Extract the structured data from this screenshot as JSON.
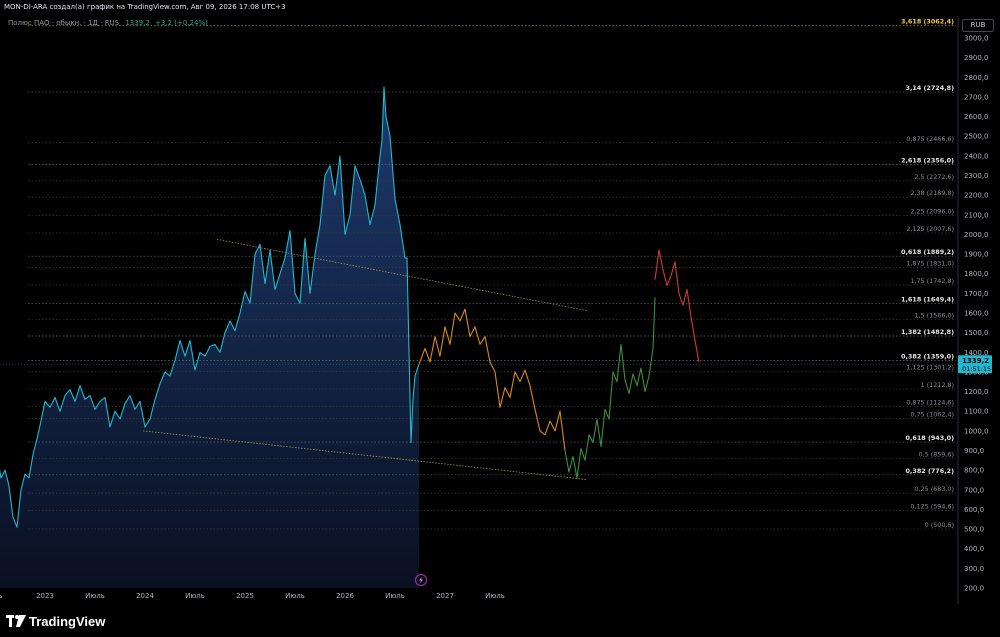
{
  "header": {
    "author_line": "MON-DI-ARA создал(а) график на TradingView.com, Авг 09, 2026 17:08 UTC+3",
    "symbol": "Полюс ПАО · обыкн. · 1Д · RUS",
    "last_price": "1339,2",
    "change": "+3,2 (+0,24%)",
    "currency": "RUB"
  },
  "footer": {
    "brand": "TradingView"
  },
  "colors": {
    "background": "#000000",
    "price_line": "#22b8cf",
    "area_fill": "#1e2d52",
    "projection_orange": "#d98a1a",
    "projection_green": "#3f8f3a",
    "projection_red": "#d13b3b",
    "trendline": "#a8a84a",
    "fib_level": "#5a5a5a",
    "price_tag_bg": "#22b8cf"
  },
  "price_tag": {
    "price": "1339,2",
    "countdown": "01:51:15"
  },
  "event_marker": {
    "icon": "lightning-bolt-icon"
  },
  "chart_data": {
    "type": "line",
    "title": "",
    "xlabel": "",
    "ylabel": "",
    "y_ticks": [
      200,
      300,
      400,
      500,
      600,
      700,
      800,
      900,
      1000,
      1100,
      1200,
      1300,
      1400,
      1500,
      1600,
      1700,
      1800,
      1900,
      2000,
      2100,
      2200,
      2300,
      2400,
      2500,
      2600,
      2700,
      2800,
      2900,
      3000
    ],
    "y_tick_labels": [
      "200,0",
      "300,0",
      "400,0",
      "500,0",
      "600,0",
      "700,0",
      "800,0",
      "900,0",
      "1000,0",
      "1100,0",
      "1200,0",
      "1300,0",
      "1400,0",
      "1500,0",
      "1600,0",
      "1700,0",
      "1800,0",
      "1900,0",
      "2000,0",
      "2100,0",
      "2200,0",
      "2300,0",
      "2400,0",
      "2500,0",
      "2600,0",
      "2700,0",
      "2800,0",
      "2900,0",
      "3000,0"
    ],
    "ylim": [
      160,
      3130
    ],
    "xlim": [
      2022.47,
      2028.42
    ],
    "x_ticks": [
      {
        "label": "юль",
        "x": 2022.5
      },
      {
        "label": "2023",
        "x": 2023.0
      },
      {
        "label": "Июль",
        "x": 2023.5
      },
      {
        "label": "2024",
        "x": 2024.0
      },
      {
        "label": "Июль",
        "x": 2024.5
      },
      {
        "label": "2025",
        "x": 2025.0
      },
      {
        "label": "Июль",
        "x": 2025.5
      },
      {
        "label": "2026",
        "x": 2026.0
      },
      {
        "label": "Июль",
        "x": 2026.5
      },
      {
        "label": "2027",
        "x": 2027.0
      },
      {
        "label": "Июль",
        "x": 2027.5
      }
    ],
    "fib_levels": [
      {
        "label": "0 (500,6)",
        "value": 500.6,
        "strong": false
      },
      {
        "label": "0,125 (594,6)",
        "value": 594.6,
        "strong": false
      },
      {
        "label": "0,25 (683,0)",
        "value": 683.0,
        "strong": false
      },
      {
        "label": "0,382 (776,2)",
        "value": 776.2,
        "strong": true
      },
      {
        "label": "0,5 (859,6)",
        "value": 859.6,
        "strong": false
      },
      {
        "label": "0,618 (943,0)",
        "value": 943.0,
        "strong": true
      },
      {
        "label": "0,75 (1062,4)",
        "value": 1062.4,
        "strong": false
      },
      {
        "label": "0,875 (1124,6)",
        "value": 1124.6,
        "strong": false
      },
      {
        "label": "1 (1212,8)",
        "value": 1212.8,
        "strong": false
      },
      {
        "label": "1,125 (1301,2)",
        "value": 1301.2,
        "strong": false
      },
      {
        "label": "0,382 (1359,0)",
        "value": 1359.0,
        "strong": true
      },
      {
        "label": "1,382 (1482,8)",
        "value": 1482.8,
        "strong": true
      },
      {
        "label": "1,5 (1566,0)",
        "value": 1566.0,
        "strong": false
      },
      {
        "label": "1,618 (1649,4)",
        "value": 1649.4,
        "strong": true
      },
      {
        "label": "1,75 (1742,8)",
        "value": 1742.8,
        "strong": false
      },
      {
        "label": "1,875 (1831,0)",
        "value": 1831.0,
        "strong": false
      },
      {
        "label": "0,618 (1889,2)",
        "value": 1889.2,
        "strong": true
      },
      {
        "label": "2,125 (2007,6)",
        "value": 2007.6,
        "strong": false
      },
      {
        "label": "2,25 (2096,0)",
        "value": 2096.0,
        "strong": false
      },
      {
        "label": "2,38 (2189,8)",
        "value": 2189.8,
        "strong": false
      },
      {
        "label": "2,5 (2272,6)",
        "value": 2272.6,
        "strong": false
      },
      {
        "label": "2,618 (2356,0)",
        "value": 2356.0,
        "strong": true
      },
      {
        "label": "0,875 (2466,6)",
        "value": 2466.6,
        "strong": false
      },
      {
        "label": "3,14 (2724,8)",
        "value": 2724.8,
        "strong": true
      },
      {
        "label": "3,618 (3062,4)",
        "value": 3062.4,
        "strong": true,
        "accent": true
      }
    ],
    "trendlines": [
      {
        "name": "upper",
        "x": [
          2024.72,
          2028.42
        ],
        "y": [
          1975,
          1612
        ]
      },
      {
        "name": "lower",
        "x": [
          2023.98,
          2028.42
        ],
        "y": [
          1000,
          752
        ]
      }
    ],
    "series": [
      {
        "name": "history",
        "color": "#22b8cf",
        "x": [
          2022.47,
          2022.52,
          2022.56,
          2022.6,
          2022.64,
          2022.68,
          2022.72,
          2022.76,
          2022.8,
          2022.84,
          2022.88,
          2022.92,
          2022.96,
          2023.0,
          2023.05,
          2023.1,
          2023.15,
          2023.2,
          2023.25,
          2023.3,
          2023.35,
          2023.4,
          2023.45,
          2023.5,
          2023.55,
          2023.6,
          2023.65,
          2023.7,
          2023.75,
          2023.8,
          2023.85,
          2023.9,
          2023.95,
          2024.0,
          2024.05,
          2024.1,
          2024.15,
          2024.2,
          2024.25,
          2024.3,
          2024.35,
          2024.4,
          2024.45,
          2024.5,
          2024.55,
          2024.6,
          2024.65,
          2024.7,
          2024.75,
          2024.8,
          2024.85,
          2024.9,
          2024.95,
          2025.0,
          2025.05,
          2025.1,
          2025.15,
          2025.2,
          2025.25,
          2025.3,
          2025.35,
          2025.4,
          2025.45,
          2025.5,
          2025.55,
          2025.6,
          2025.65,
          2025.7,
          2025.75,
          2025.8,
          2025.85,
          2025.9,
          2025.95,
          2026.0,
          2026.05,
          2026.1,
          2026.15,
          2026.2,
          2026.25,
          2026.3,
          2026.35,
          2026.37,
          2026.39,
          2026.41,
          2026.45,
          2026.5,
          2026.55,
          2026.6,
          2026.62
        ],
        "y": [
          950,
          880,
          760,
          800,
          720,
          560,
          510,
          700,
          780,
          760,
          880,
          960,
          1050,
          1150,
          1120,
          1170,
          1100,
          1180,
          1210,
          1150,
          1230,
          1160,
          1180,
          1110,
          1150,
          1170,
          1020,
          1100,
          1060,
          1140,
          1180,
          1110,
          1150,
          1020,
          1060,
          1160,
          1240,
          1300,
          1280,
          1360,
          1460,
          1380,
          1460,
          1310,
          1400,
          1380,
          1430,
          1440,
          1400,
          1500,
          1560,
          1510,
          1600,
          1710,
          1650,
          1900,
          1950,
          1750,
          1920,
          1720,
          1800,
          1880,
          2020,
          1700,
          1650,
          1980,
          1700,
          1900,
          2050,
          2300,
          2350,
          2200,
          2400,
          2000,
          2100,
          2350,
          2280,
          2200,
          2050,
          2150,
          2400,
          2480,
          2750,
          2600,
          2500,
          2180,
          2050,
          1880,
          1880
        ]
      },
      {
        "name": "crash",
        "color": "#22b8cf",
        "x": [
          2026.62,
          2026.64,
          2026.66,
          2026.68,
          2026.7,
          2026.72,
          2026.74
        ],
        "y": [
          1880,
          1400,
          940,
          1160,
          1280,
          1310,
          1339
        ]
      },
      {
        "name": "projection-orange",
        "color": "#d98a1a",
        "x": [
          2026.74,
          2026.8,
          2026.85,
          2026.9,
          2026.95,
          2027.0,
          2027.05,
          2027.1,
          2027.15,
          2027.2,
          2027.25,
          2027.3,
          2027.35,
          2027.4,
          2027.45,
          2027.5,
          2027.55,
          2027.6,
          2027.65,
          2027.7,
          2027.75,
          2027.8,
          2027.85,
          2027.9,
          2027.95,
          2028.0,
          2028.05,
          2028.1,
          2028.15,
          2028.2
        ],
        "y": [
          1339,
          1420,
          1350,
          1480,
          1380,
          1530,
          1440,
          1600,
          1560,
          1620,
          1480,
          1530,
          1440,
          1480,
          1350,
          1300,
          1120,
          1220,
          1170,
          1300,
          1250,
          1310,
          1230,
          1110,
          1000,
          980,
          1050,
          1000,
          1100,
          900
        ]
      },
      {
        "name": "projection-green",
        "color": "#3f8f3a",
        "x": [
          2028.2,
          2028.24,
          2028.28,
          2028.32,
          2028.36,
          2028.4,
          2028.44,
          2028.48,
          2028.52,
          2028.56,
          2028.6,
          2028.64,
          2028.68,
          2028.72,
          2028.76,
          2028.8,
          2028.84,
          2028.88,
          2028.92,
          2028.96,
          2029.0,
          2029.04,
          2029.08,
          2029.1
        ],
        "y": [
          900,
          790,
          870,
          760,
          910,
          850,
          980,
          940,
          1060,
          920,
          1110,
          1060,
          1300,
          1250,
          1440,
          1260,
          1190,
          1290,
          1230,
          1320,
          1200,
          1280,
          1420,
          1680
        ]
      },
      {
        "name": "projection-red",
        "color": "#d13b3b",
        "x": [
          2029.1,
          2029.14,
          2029.18,
          2029.22,
          2029.26,
          2029.3,
          2029.34,
          2029.38,
          2029.42,
          2029.46,
          2029.5,
          2029.54
        ],
        "y": [
          1770,
          1920,
          1820,
          1740,
          1790,
          1860,
          1700,
          1640,
          1720,
          1580,
          1460,
          1350
        ]
      }
    ],
    "grid": true,
    "scale": "linear"
  }
}
